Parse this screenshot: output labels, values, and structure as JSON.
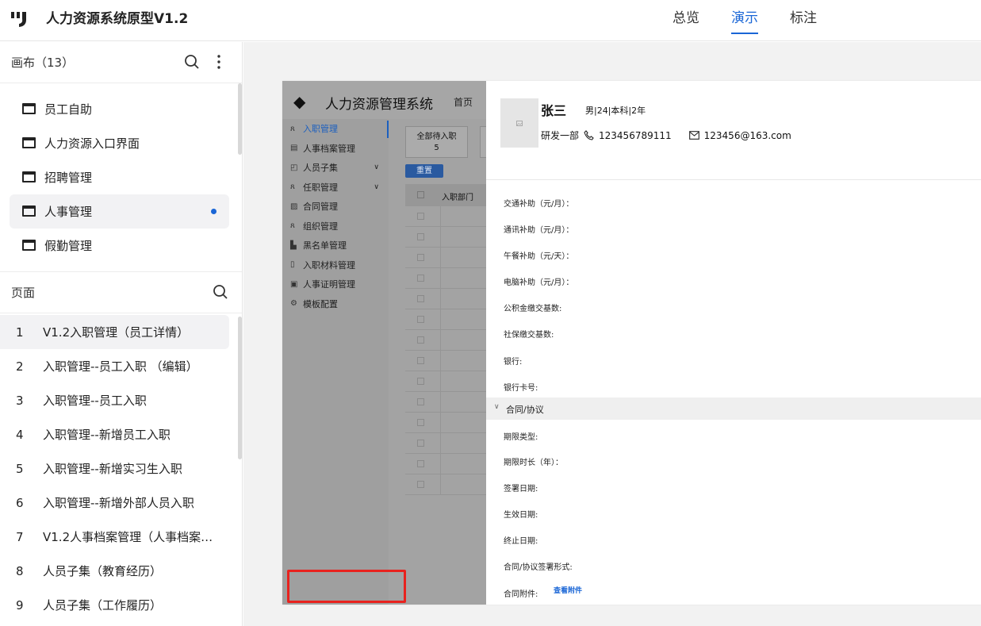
{
  "app": {
    "title": "人力资源系统原型V1.2"
  },
  "top_tabs": [
    {
      "label": "总览",
      "active": false
    },
    {
      "label": "演示",
      "active": true
    },
    {
      "label": "标注",
      "active": false
    }
  ],
  "canvas_section": {
    "title": "画布（13）",
    "items": [
      {
        "label": "员工自助"
      },
      {
        "label": "人力资源入口界面"
      },
      {
        "label": "招聘管理"
      },
      {
        "label": "人事管理",
        "active": true
      },
      {
        "label": "假勤管理"
      }
    ]
  },
  "pages_section": {
    "title": "页面",
    "items": [
      {
        "num": "1",
        "label": "V1.2入职管理（员工详情）",
        "active": true
      },
      {
        "num": "2",
        "label": "入职管理--员工入职 （编辑）"
      },
      {
        "num": "3",
        "label": "入职管理--员工入职"
      },
      {
        "num": "4",
        "label": "入职管理--新增员工入职"
      },
      {
        "num": "5",
        "label": "入职管理--新增实习生入职"
      },
      {
        "num": "6",
        "label": "入职管理--新增外部人员入职"
      },
      {
        "num": "7",
        "label": "V1.2人事档案管理（人事档案…"
      },
      {
        "num": "8",
        "label": "人员子集（教育经历）"
      },
      {
        "num": "9",
        "label": "人员子集（工作履历）"
      }
    ]
  },
  "prototype": {
    "system_title": "人力资源管理系统",
    "home": "首页",
    "menu": [
      {
        "label": "入职管理",
        "icon": "user-icon",
        "active": true
      },
      {
        "label": "人事档案管理",
        "icon": "file-icon"
      },
      {
        "label": "人员子集",
        "icon": "person-card-icon",
        "expand": "∨"
      },
      {
        "label": "任职管理",
        "icon": "user-icon",
        "expand": "∨"
      },
      {
        "label": "合同管理",
        "icon": "contract-icon"
      },
      {
        "label": "组织管理",
        "icon": "user-icon"
      },
      {
        "label": "黑名单管理",
        "icon": "block-icon"
      },
      {
        "label": "入职材料管理",
        "icon": "doc-icon"
      },
      {
        "label": "人事证明管理",
        "icon": "certificate-icon"
      },
      {
        "label": "模板配置",
        "icon": "settings-icon"
      }
    ],
    "card": {
      "label": "全部待入职",
      "count": "5"
    },
    "reset_button": "重置",
    "table_header": "入职部门",
    "employee": {
      "name": "张三",
      "meta": "男|24|本科|2年",
      "department": "研发一部",
      "phone": "123456789111",
      "email": "123456@163.com"
    },
    "fields_group1": [
      "交通补助（元/月）：",
      "通讯补助（元/月）：",
      "午餐补助（元/天）：",
      "电脑补助（元/月）：",
      "公积金缴交基数:",
      "社保缴交基数:",
      "银行:",
      "银行卡号:"
    ],
    "section_title": "合同/协议",
    "fields_group2": [
      "期限类型:",
      "期限时长（年）：",
      " 签署日期:",
      "生效日期:",
      "终止日期:",
      "合同/协议签署形式:",
      "合同附件:"
    ],
    "attachment_link": "查看附件"
  }
}
